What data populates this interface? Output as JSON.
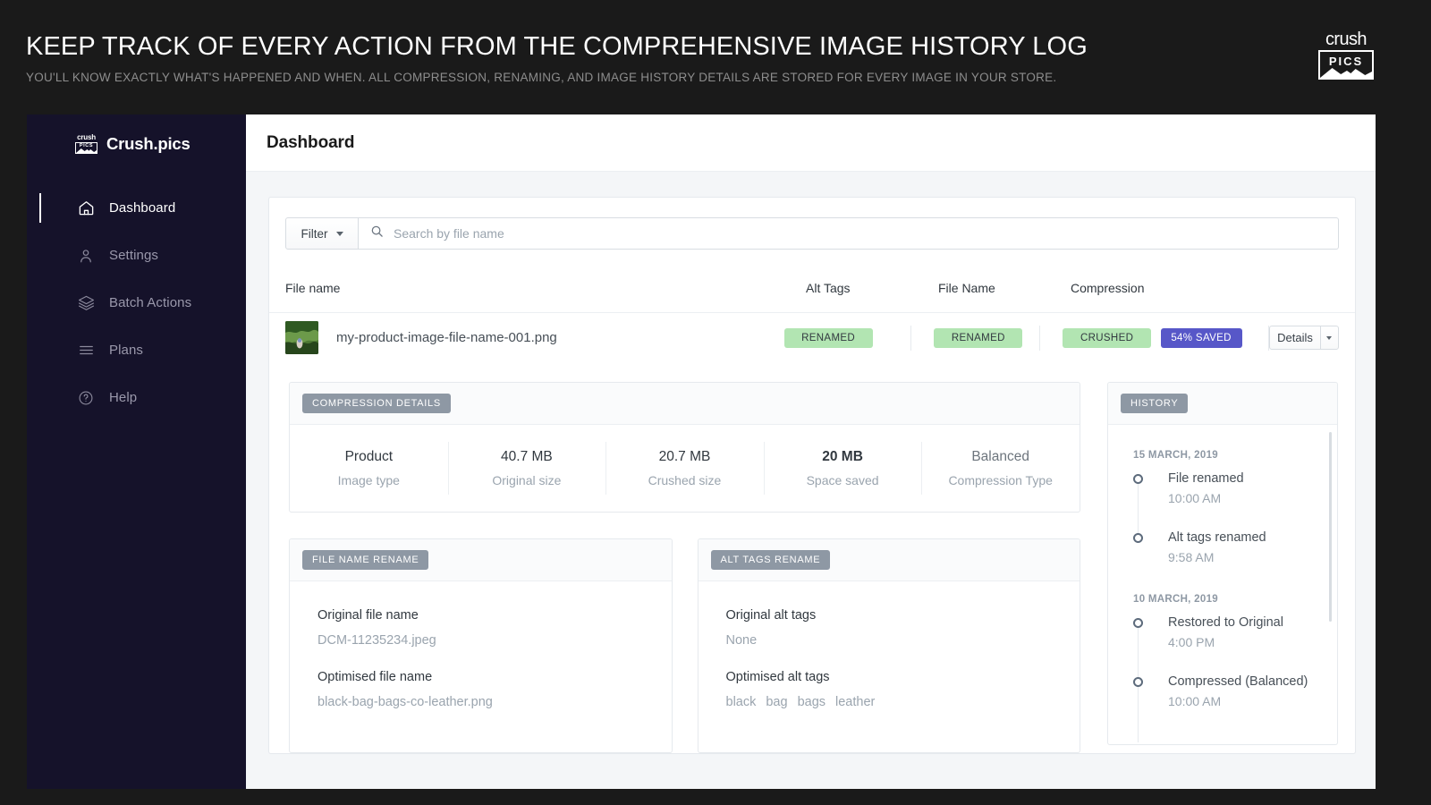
{
  "promo": {
    "title": "KEEP TRACK OF EVERY ACTION FROM THE COMPREHENSIVE IMAGE HISTORY LOG",
    "subtitle": "YOU'LL KNOW EXACTLY WHAT'S HAPPENED AND WHEN. ALL COMPRESSION, RENAMING, AND IMAGE HISTORY DETAILS ARE STORED FOR EVERY IMAGE IN YOUR STORE.",
    "logo": {
      "word_top": "crush",
      "word_bottom": "PICS"
    }
  },
  "sidebar": {
    "brand": "Crush.pics",
    "logo": {
      "word_top": "crush",
      "word_bottom": "PICS"
    },
    "items": [
      {
        "label": "Dashboard",
        "icon": "home-icon",
        "active": true
      },
      {
        "label": "Settings",
        "icon": "user-icon",
        "active": false
      },
      {
        "label": "Batch Actions",
        "icon": "layers-icon",
        "active": false
      },
      {
        "label": "Plans",
        "icon": "menu-lines-icon",
        "active": false
      },
      {
        "label": "Help",
        "icon": "question-circle-icon",
        "active": false
      }
    ]
  },
  "header": {
    "title": "Dashboard"
  },
  "toolbar": {
    "filter_label": "Filter",
    "search_placeholder": "Search by file name",
    "search_value": ""
  },
  "table": {
    "columns": [
      "File name",
      "Alt Tags",
      "File Name",
      "Compression"
    ],
    "rows": [
      {
        "file_name": "my-product-image-file-name-001.png",
        "alt_tags_badge": "RENAMED",
        "file_name_badge": "RENAMED",
        "compression_badge": "CRUSHED",
        "saved_badge": "54% SAVED",
        "details_label": "Details"
      }
    ]
  },
  "compression_details": {
    "section_title": "COMPRESSION DETAILS",
    "stats": [
      {
        "value": "Product",
        "label": "Image type"
      },
      {
        "value": "40.7 MB",
        "label": "Original size"
      },
      {
        "value": "20.7 MB",
        "label": "Crushed size"
      },
      {
        "value": "20 MB",
        "label": "Space saved"
      },
      {
        "value": "Balanced",
        "label": "Compression Type"
      }
    ]
  },
  "file_name_rename": {
    "section_title": "FILE NAME RENAME",
    "original_label": "Original file name",
    "original_value": "DCM-11235234.jpeg",
    "optimised_label": "Optimised file name",
    "optimised_value": "black-bag-bags-co-leather.png"
  },
  "alt_tags_rename": {
    "section_title": "ALT TAGS RENAME",
    "original_label": "Original alt tags",
    "original_value": "None",
    "optimised_label": "Optimised alt tags",
    "optimised_tags": [
      "black",
      "bag",
      "bags",
      "leather"
    ]
  },
  "history": {
    "section_title": "HISTORY",
    "groups": [
      {
        "date": "15 MARCH, 2019",
        "entries": [
          {
            "title": "File renamed",
            "time": "10:00 AM"
          },
          {
            "title": "Alt tags renamed",
            "time": "9:58 AM"
          }
        ]
      },
      {
        "date": "10 MARCH, 2019",
        "entries": [
          {
            "title": "Restored to Original",
            "time": "4:00 PM"
          },
          {
            "title": "Compressed (Balanced)",
            "time": "10:00 AM"
          }
        ]
      }
    ]
  },
  "colors": {
    "promo_bg": "#1a1a1a",
    "sidebar_bg": "#15122a",
    "app_bg": "#f4f6f8",
    "badge_green": "#b2e5b2",
    "badge_purple": "#5757c8",
    "pill_grey": "#8e98a4"
  }
}
